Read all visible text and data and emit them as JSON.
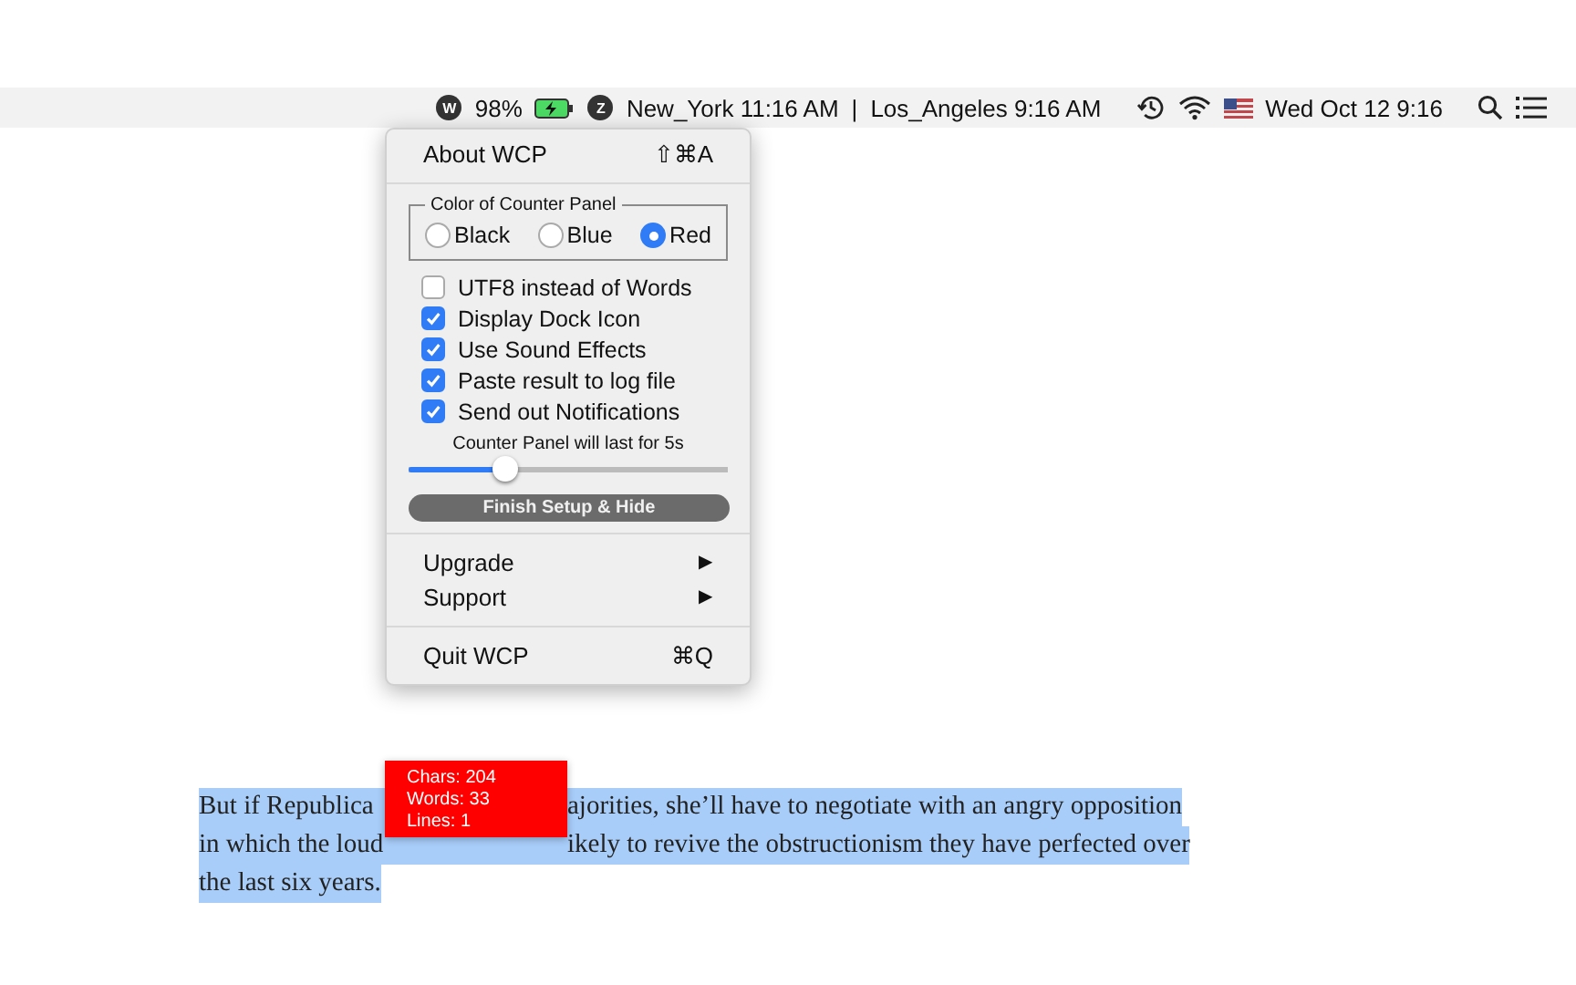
{
  "menu_bar": {
    "items": [
      {
        "kind": "badge",
        "text": "W"
      },
      {
        "kind": "text",
        "text": "98%"
      },
      {
        "kind": "battery"
      },
      {
        "kind": "badge",
        "text": "Z"
      },
      {
        "kind": "text",
        "text": "New_York 11:16 AM"
      },
      {
        "kind": "text",
        "text": "|"
      },
      {
        "kind": "text",
        "text": "Los_Angeles 9:16 AM"
      },
      {
        "kind": "clock"
      },
      {
        "kind": "wifi"
      },
      {
        "kind": "flag"
      },
      {
        "kind": "text",
        "text": "Wed Oct 12  9:16"
      },
      {
        "kind": "search"
      },
      {
        "kind": "list"
      }
    ]
  },
  "menu": {
    "about": {
      "label": "About WCP",
      "shortcut": "⇧⌘A"
    },
    "color_group": {
      "title": "Color of Counter Panel",
      "options": [
        {
          "label": "Black",
          "selected": false
        },
        {
          "label": "Blue",
          "selected": false
        },
        {
          "label": "Red",
          "selected": true
        }
      ]
    },
    "options": [
      {
        "label": "UTF8 instead of Words",
        "checked": false
      },
      {
        "label": "Display Dock Icon",
        "checked": true
      },
      {
        "label": "Use Sound Effects",
        "checked": true
      },
      {
        "label": "Paste result to log file",
        "checked": true
      },
      {
        "label": "Send out Notifications",
        "checked": true
      }
    ],
    "slider": {
      "label": "Counter Panel will last for 5s",
      "level": 0.3
    },
    "button": "Finish Setup & Hide",
    "submenus": [
      {
        "label": "Upgrade",
        "arrow": "▶"
      },
      {
        "label": "Support",
        "arrow": "▶"
      }
    ],
    "quit": {
      "label": "Quit WCP",
      "shortcut": "⌘Q"
    }
  },
  "counter_panel": {
    "lines": [
      "Chars: 204",
      "Words: 33",
      "Lines: 1"
    ]
  },
  "document": {
    "lines": [
      {
        "before": "But if Republica",
        "after": "ajorities, she’ll have to negotiate with an angry opposition"
      },
      {
        "before": "in which the loud",
        "after": "ikely to revive the obstructionism they have perfected over"
      },
      {
        "before": "the last six years."
      }
    ]
  }
}
